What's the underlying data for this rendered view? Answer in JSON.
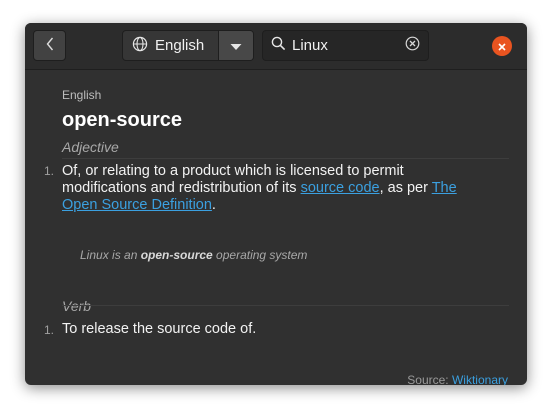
{
  "header": {
    "language": "English",
    "search_value": "Linux",
    "search_placeholder": ""
  },
  "entry": {
    "language_caption": "English",
    "word": "open-source",
    "senses": [
      {
        "part_of_speech": "Adjective",
        "definitions": [
          {
            "number": "1.",
            "text_before": "Of, or relating to a product which is licensed to permit modifications and redistribution of its ",
            "link1": "source code",
            "text_middle": ", as per ",
            "link2": "The Open Source Definition",
            "text_after": "."
          }
        ],
        "example": {
          "before": "Linux is an ",
          "bold": "open-source",
          "after": " operating system"
        }
      },
      {
        "part_of_speech": "Verb",
        "definitions": [
          {
            "number": "1.",
            "text": "To release the source code of."
          }
        ]
      }
    ]
  },
  "footer": {
    "source_label": "Source: ",
    "source_link": "Wiktionary"
  },
  "colors": {
    "window_bg": "#303030",
    "header_bg": "#2c2c2c",
    "link": "#3ba0e0",
    "close_button": "#e95420"
  },
  "icons": {
    "back": "chevron-left-icon",
    "language": "globe-icon",
    "dropdown": "chevron-down-icon",
    "search": "search-icon",
    "clear": "clear-icon",
    "close": "close-icon"
  }
}
